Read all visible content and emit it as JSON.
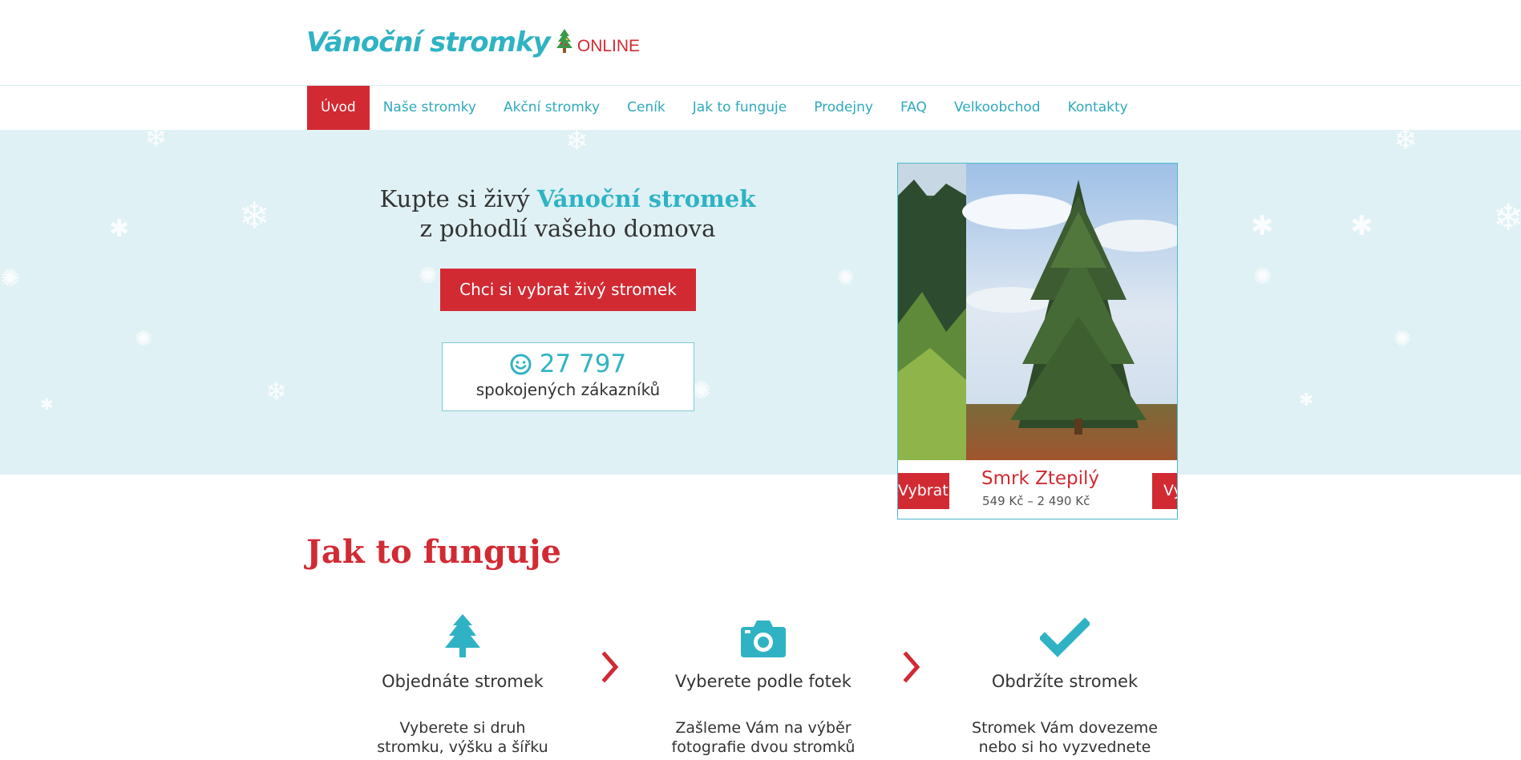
{
  "header": {
    "logo_main": "Vánoční stromky",
    "logo_online": "ONLINE"
  },
  "nav": {
    "items": [
      {
        "label": "Úvod",
        "active": true
      },
      {
        "label": "Naše stromky"
      },
      {
        "label": "Akční stromky"
      },
      {
        "label": "Ceník"
      },
      {
        "label": "Jak to funguje"
      },
      {
        "label": "Prodejny"
      },
      {
        "label": "FAQ"
      },
      {
        "label": "Velkoobchod"
      },
      {
        "label": "Kontakty"
      }
    ]
  },
  "hero": {
    "title_part1": "Kupte si živý ",
    "title_accent": "Vánoční stromek",
    "title_line2": "z pohodlí vašeho domova",
    "cta_label": "Chci si vybrat živý stromek",
    "counter_icon": "smiley-icon",
    "counter_value": "27 797",
    "counter_label": "spokojených zákazníků"
  },
  "slider": {
    "prev_label": "Vybrat",
    "next_label": "Vybrat",
    "current": {
      "name": "Smrk Ztepilý",
      "price": "549 Kč – 2 490 Kč"
    }
  },
  "how": {
    "title": "Jak to funguje",
    "steps": [
      {
        "icon": "tree-icon",
        "title": "Objednáte stromek",
        "text_line1": "Vyberete si druh",
        "text_line2": "stromku, výšku a šířku"
      },
      {
        "icon": "camera-icon",
        "title": "Vyberete podle fotek",
        "text_line1": "Zašleme Vám na výběr",
        "text_line2": "fotografie dvou stromků"
      },
      {
        "icon": "check-icon",
        "title": "Obdržíte stromek",
        "text_line1": "Stromek Vám dovezeme",
        "text_line2": "nebo si ho vyzvednete"
      }
    ]
  },
  "colors": {
    "brand_red": "#d22a33",
    "brand_teal": "#2fb3c4",
    "hero_bg": "#dff1f4"
  }
}
